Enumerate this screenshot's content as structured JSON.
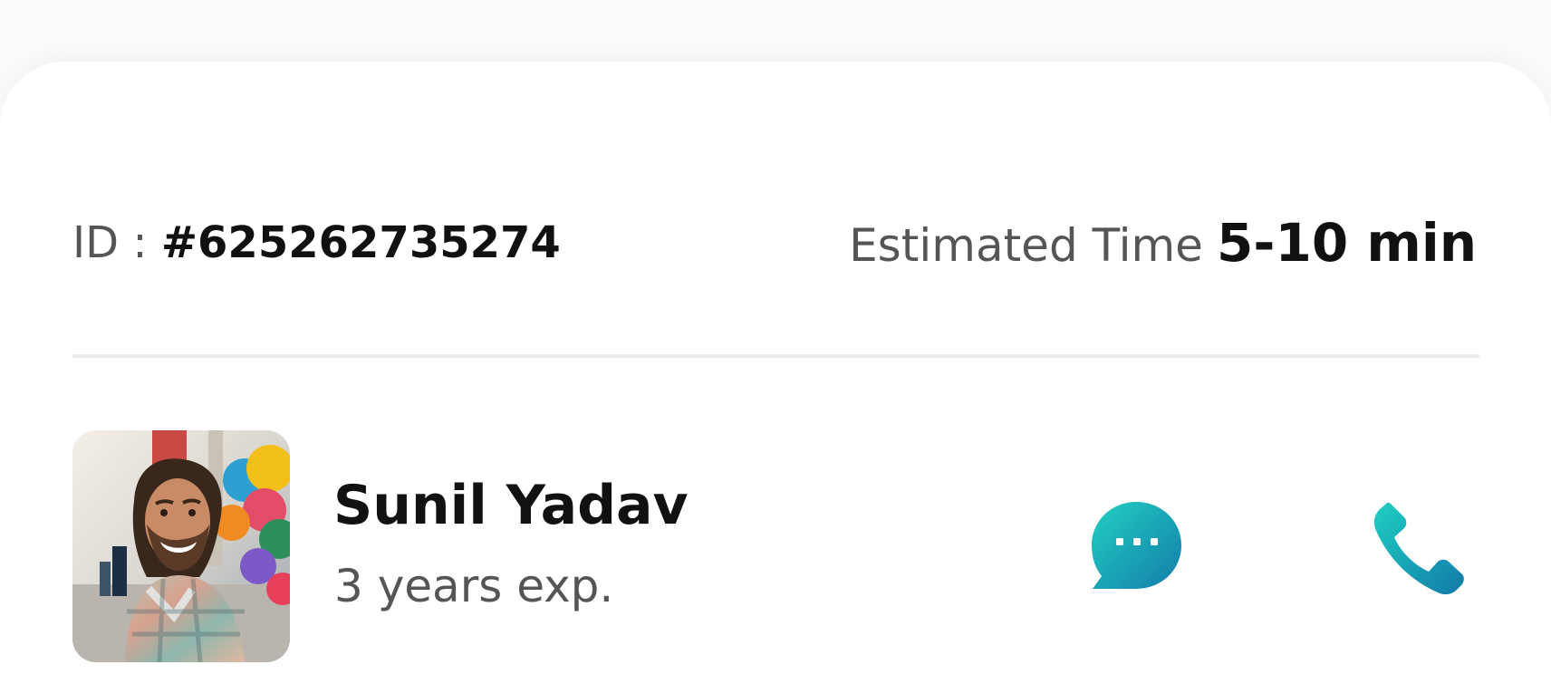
{
  "order": {
    "id_label": "ID :",
    "id_value": "#625262735274",
    "estimated_label": "Estimated Time",
    "estimated_value": "5-10 min"
  },
  "provider": {
    "name": "Sunil Yadav",
    "experience": "3 years exp."
  },
  "actions": {
    "chat_icon": "chat-bubble-icon",
    "call_icon": "phone-icon"
  },
  "colors": {
    "accent_start": "#1ECBC0",
    "accent_end": "#127BA9",
    "text_primary": "#111111",
    "text_secondary": "#555555"
  }
}
